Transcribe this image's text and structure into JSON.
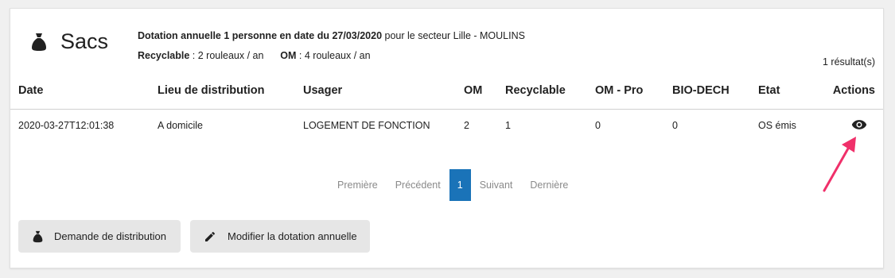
{
  "header": {
    "title": "Sacs",
    "icon": "money-bag-icon"
  },
  "info": {
    "line1_bold": "Dotation annuelle 1 personne en date du 27/03/2020",
    "line1_rest": " pour le secteur Lille - MOULINS",
    "recyclable_label": "Recyclable",
    "recyclable_value": " : 2 rouleaux / an",
    "om_label": "OM",
    "om_value": " : 4 rouleaux / an"
  },
  "results_count": "1 résultat(s)",
  "table": {
    "columns": [
      "Date",
      "Lieu de distribution",
      "Usager",
      "OM",
      "Recyclable",
      "OM - Pro",
      "BIO-DECH",
      "Etat",
      "Actions"
    ],
    "rows": [
      [
        "2020-03-27T12:01:38",
        "A domicile",
        "LOGEMENT DE FONCTION",
        "2",
        "1",
        "0",
        "0",
        "OS émis",
        "eye-icon"
      ]
    ]
  },
  "pagination": {
    "first": "Première",
    "prev": "Précédent",
    "current": "1",
    "next": "Suivant",
    "last": "Dernière"
  },
  "buttons": {
    "request": "Demande de distribution",
    "modify": "Modifier la dotation annuelle"
  },
  "colors": {
    "accent": "#1a73b8",
    "annotation_arrow": "#f0306a"
  }
}
